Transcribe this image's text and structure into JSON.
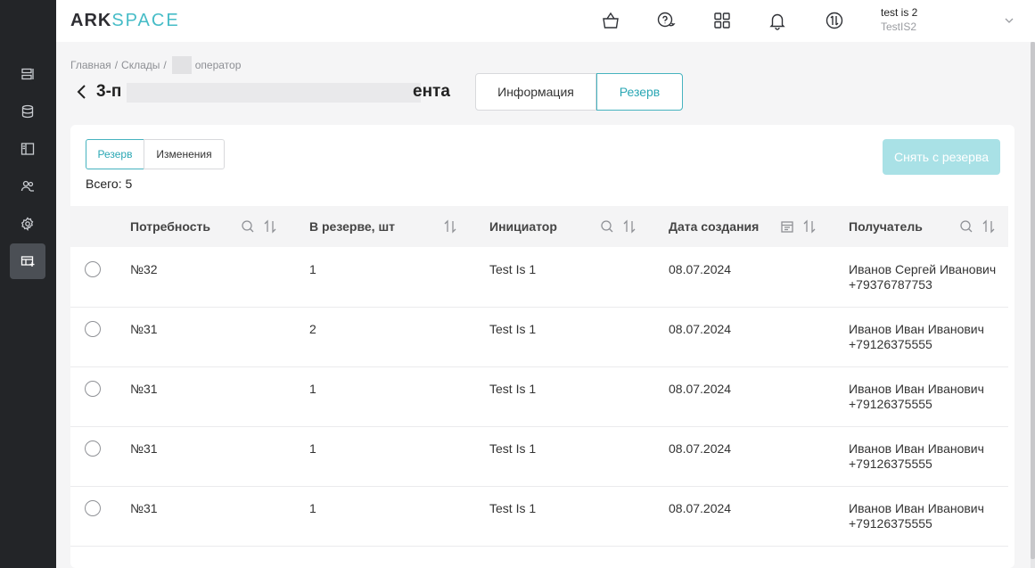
{
  "logo": {
    "ark": "ARK",
    "space": "SPACE"
  },
  "user": {
    "name": "test is 2",
    "login": "TestIS2"
  },
  "breadcrumb": {
    "home": "Главная",
    "warehouses": "Склады",
    "separator": "/",
    "current": "оператор"
  },
  "page": {
    "title_start": "3-п",
    "title_end": "ента"
  },
  "top_tabs": {
    "info": "Информация",
    "reserve": "Резерв"
  },
  "sub_tabs": {
    "reserve": "Резерв",
    "changes": "Изменения"
  },
  "total_label": "Всего: 5",
  "unreserve_button": "Снять с резерва",
  "columns": {
    "need": "Потребность",
    "qty": "В резерве, шт",
    "initiator": "Инициатор",
    "created": "Дата создания",
    "recipient": "Получатель"
  },
  "rows": [
    {
      "need": "№32",
      "qty": "1",
      "initiator": "Test Is 1",
      "created": "08.07.2024",
      "recipient_name": "Иванов Сергей Иванович",
      "recipient_phone": "+79376787753"
    },
    {
      "need": "№31",
      "qty": "2",
      "initiator": "Test Is 1",
      "created": "08.07.2024",
      "recipient_name": "Иванов Иван Иванович",
      "recipient_phone": "+79126375555"
    },
    {
      "need": "№31",
      "qty": "1",
      "initiator": "Test Is 1",
      "created": "08.07.2024",
      "recipient_name": "Иванов Иван Иванович",
      "recipient_phone": "+79126375555"
    },
    {
      "need": "№31",
      "qty": "1",
      "initiator": "Test Is 1",
      "created": "08.07.2024",
      "recipient_name": "Иванов Иван Иванович",
      "recipient_phone": "+79126375555"
    },
    {
      "need": "№31",
      "qty": "1",
      "initiator": "Test Is 1",
      "created": "08.07.2024",
      "recipient_name": "Иванов Иван Иванович",
      "recipient_phone": "+79126375555"
    }
  ],
  "colors": {
    "accent": "#46b3bf",
    "sidebar": "#232528",
    "button_disabled": "#a9e1e6"
  },
  "icons": {
    "sidebar": [
      "list-icon",
      "database-icon",
      "layout-icon",
      "users-icon",
      "settings-icon",
      "warehouse-table-icon"
    ],
    "header": [
      "basket-icon",
      "chat-help-icon",
      "grid-icon",
      "bell-icon",
      "sync-icon"
    ]
  }
}
